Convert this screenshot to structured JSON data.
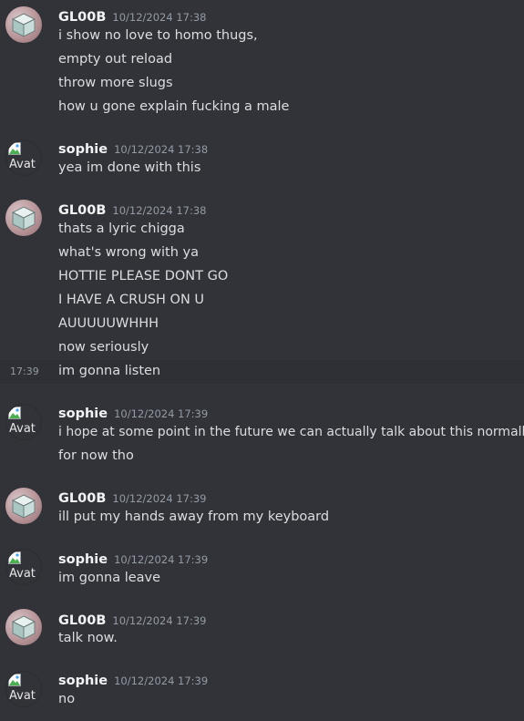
{
  "users": {
    "gloob": "GL00B",
    "sophie": "sophie"
  },
  "avatar_alt": "Avat",
  "messages": [
    {
      "author": "GL00B",
      "timestamp": "10/12/2024 17:38",
      "lines": [
        "i show no love to homo thugs,",
        "empty out reload",
        "throw more slugs",
        "how u gone explain fucking a male"
      ]
    },
    {
      "author": "sophie",
      "timestamp": "10/12/2024 17:38",
      "lines": [
        "yea im done with this"
      ]
    },
    {
      "author": "GL00B",
      "timestamp": "10/12/2024 17:38",
      "lines": [
        "thats a lyric chigga",
        "what's wrong with ya",
        "HOTTIE PLEASE DONT GO",
        "I HAVE A CRUSH ON U",
        "AUUUUUWHHH",
        "now seriously",
        "im gonna listen"
      ],
      "hover_time": "17:39"
    },
    {
      "author": "sophie",
      "timestamp": "10/12/2024 17:39",
      "lines": [
        "i hope at some point in the future we can actually talk about this normally",
        "for now tho"
      ]
    },
    {
      "author": "GL00B",
      "timestamp": "10/12/2024 17:39",
      "lines": [
        "ill put my hands away from my keyboard"
      ]
    },
    {
      "author": "sophie",
      "timestamp": "10/12/2024 17:39",
      "lines": [
        "im gonna leave"
      ]
    },
    {
      "author": "GL00B",
      "timestamp": "10/12/2024 17:39",
      "lines": [
        "talk now."
      ]
    },
    {
      "author": "sophie",
      "timestamp": "10/12/2024 17:39",
      "lines": [
        "no"
      ]
    }
  ]
}
